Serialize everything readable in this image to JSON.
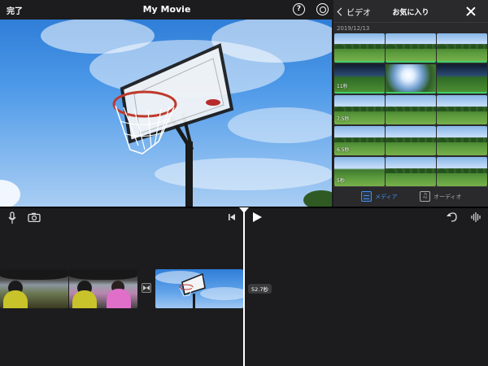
{
  "topbar": {
    "done_label": "完了",
    "title": "My Movie",
    "help_glyph": "?"
  },
  "browser": {
    "back_label": "ビデオ",
    "title": "お気に入り",
    "date_label": "2019/12/13",
    "rows": [
      [
        {
          "duration": "",
          "style": "plain",
          "used": true
        },
        {
          "duration": "",
          "style": "plain",
          "used": true
        },
        {
          "duration": "",
          "style": "plain",
          "used": true
        }
      ],
      [
        {
          "duration": "11秒",
          "style": "dark",
          "used": true
        },
        {
          "duration": "",
          "style": "bright",
          "used": true
        },
        {
          "duration": "",
          "style": "dark",
          "used": true
        }
      ],
      [
        {
          "duration": "7.5秒",
          "style": "plain",
          "used": false
        },
        {
          "duration": "",
          "style": "plain",
          "used": false
        },
        {
          "duration": "",
          "style": "plain",
          "used": false
        }
      ],
      [
        {
          "duration": "6.5秒",
          "style": "plain",
          "used": false
        },
        {
          "duration": "",
          "style": "plain",
          "used": false
        },
        {
          "duration": "",
          "style": "plain",
          "used": false
        }
      ],
      [
        {
          "duration": "5秒",
          "style": "plain",
          "used": false
        },
        {
          "duration": "",
          "style": "plain",
          "used": false
        },
        {
          "duration": "",
          "style": "plain",
          "used": false
        }
      ]
    ],
    "tabs": {
      "media_label": "メディア",
      "audio_label": "オーディオ",
      "audio_glyph": "♫"
    }
  },
  "timeline": {
    "duration_badge": "52.7秒"
  },
  "colors": {
    "accent": "#3d8ef0",
    "used_marker": "#3fd06b",
    "background": "#1c1c1e"
  }
}
